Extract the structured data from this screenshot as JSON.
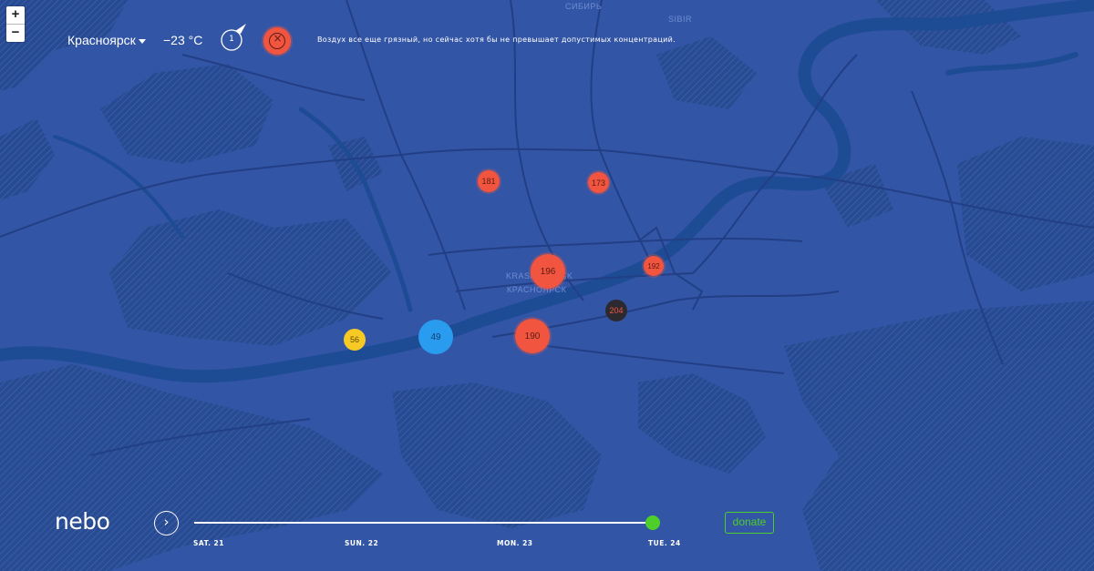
{
  "controls": {
    "zoom_in": "+",
    "zoom_out": "−"
  },
  "header": {
    "city": "Красноярск",
    "temperature": "−23 °C",
    "wind_speed": "1",
    "message": "Воздух все еще грязный, но сейчас хотя бы не превышает допустимых концентраций."
  },
  "colors": {
    "background": "#3355a6",
    "water": "#1d4c95",
    "pollution_high": "#f2553f",
    "pollution_moderate": "#f7c925",
    "pollution_low": "#2a9cf0",
    "pollution_extreme": "#2c2a2f",
    "accent": "#4ece2a"
  },
  "map_labels": {
    "city": "KRASNOYARSK",
    "city_ru": "КРАСНОЯРСК",
    "sibir_ru": "СИБИРЬ",
    "sibir": "SIBIR"
  },
  "stations": {
    "s181": {
      "value": "181",
      "level": "high"
    },
    "s173": {
      "value": "173",
      "level": "high"
    },
    "s196": {
      "value": "196",
      "level": "high"
    },
    "s192": {
      "value": "192",
      "level": "high"
    },
    "s204": {
      "value": "204",
      "level": "extreme"
    },
    "s190": {
      "value": "190",
      "level": "high"
    },
    "s49": {
      "value": "49",
      "level": "low"
    },
    "s56": {
      "value": "56",
      "level": "moderate"
    }
  },
  "footer": {
    "logo": "nebo",
    "play_icon": "chevron-right-icon",
    "days": {
      "sat": "SAT. 21",
      "sun": "SUN. 22",
      "mon": "MON. 23",
      "tue": "TUE. 24"
    },
    "timeline_progress": 1.0,
    "donate": "donate"
  }
}
